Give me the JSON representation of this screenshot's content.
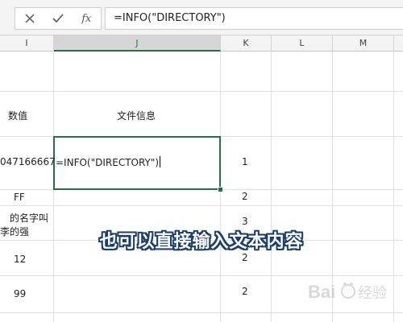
{
  "formula_bar": {
    "cancel_icon": "close-icon",
    "confirm_icon": "check-icon",
    "function_icon_label": "fx",
    "formula": "=INFO(\"DIRECTORY\")"
  },
  "columns": [
    {
      "label": "I"
    },
    {
      "label": "J"
    },
    {
      "label": "K"
    },
    {
      "label": "L"
    },
    {
      "label": "M"
    }
  ],
  "rows": [
    {
      "i": "",
      "j": "",
      "k": ""
    },
    {
      "i": "数值",
      "j": "文件信息",
      "k": ""
    },
    {
      "i": "047166667",
      "j": "=INFO(\"DIRECTORY\")",
      "k": "1"
    },
    {
      "i": "FF",
      "j": "",
      "k": "2"
    },
    {
      "i": "的名字叫",
      "i2": "李的强",
      "j": "",
      "k": "3"
    },
    {
      "i": "12",
      "j": "",
      "k": "2"
    },
    {
      "i": "99",
      "j": "",
      "k": "2"
    }
  ],
  "subtitle": "也可以直接输入文本内容",
  "watermark": "Bai 经验",
  "colors": {
    "accent": "#217346",
    "subtitle_outline": "#1c3f6e",
    "grid": "#e1e1e1"
  }
}
